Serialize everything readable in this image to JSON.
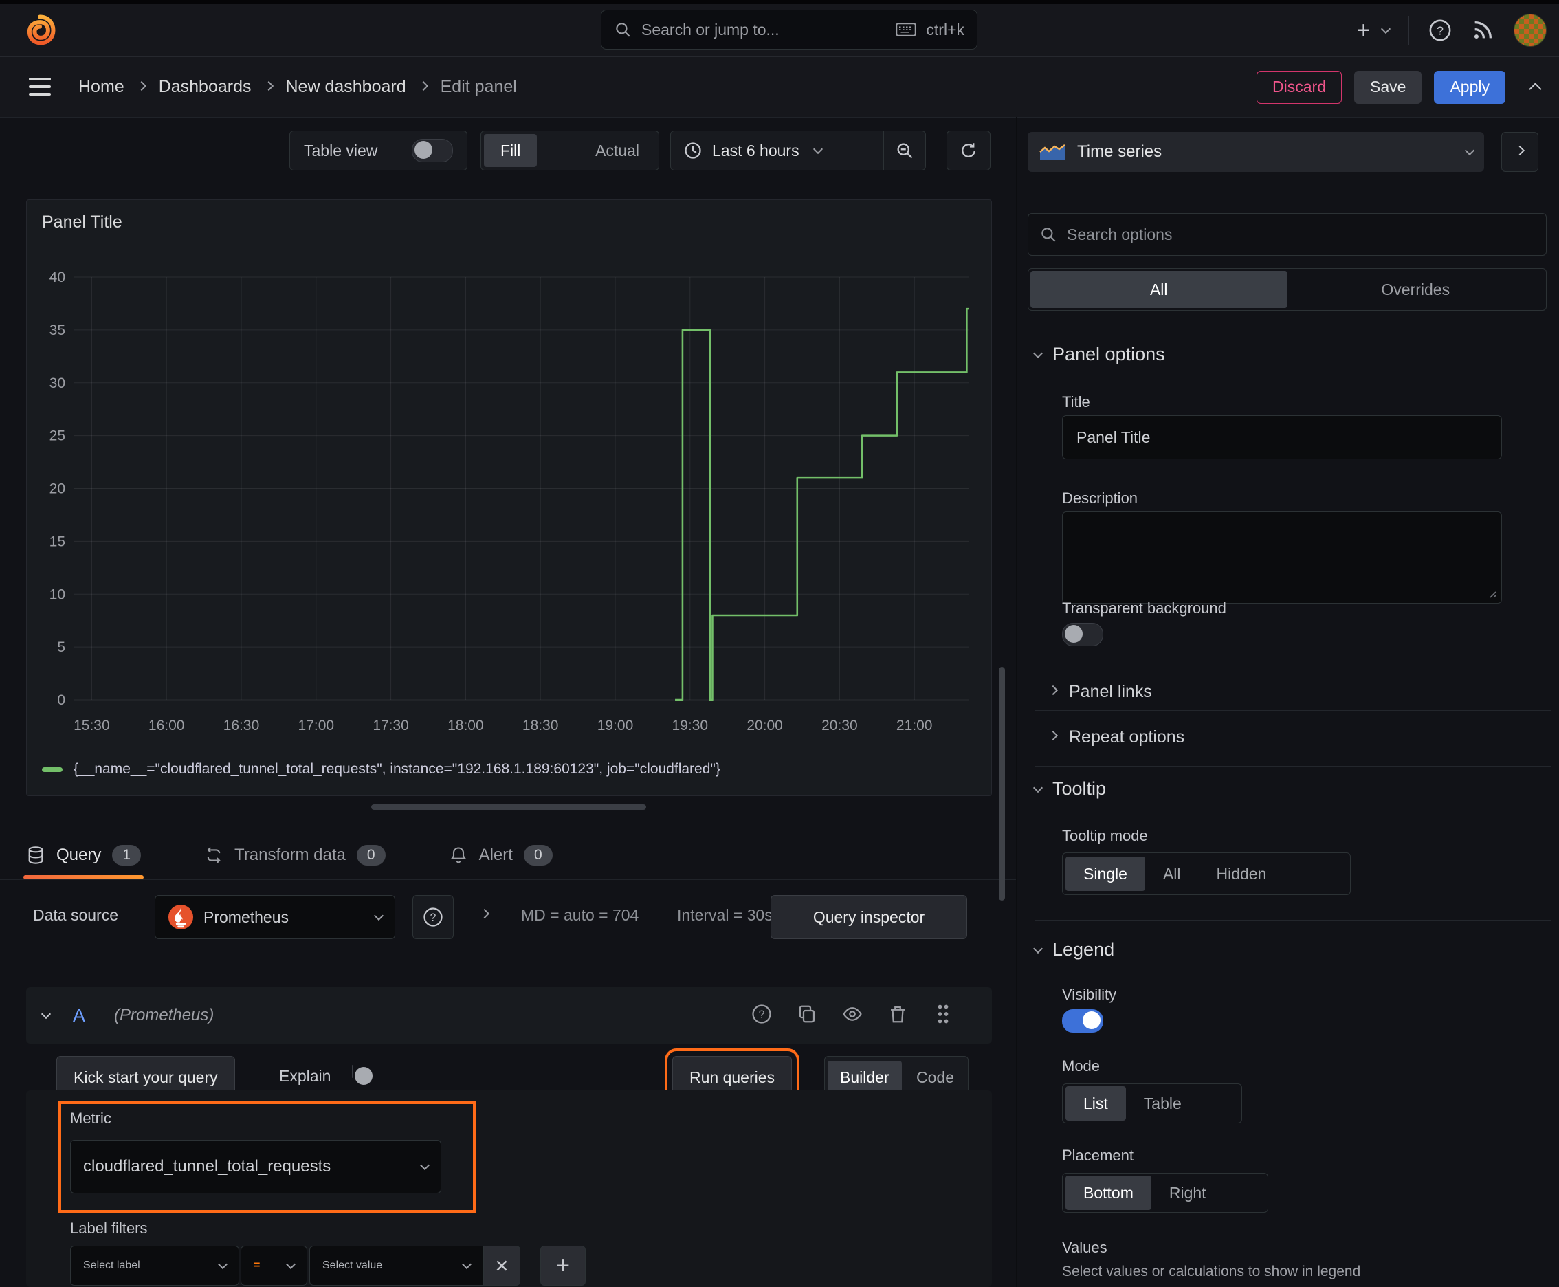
{
  "topbar": {
    "search_placeholder": "Search or jump to...",
    "search_shortcut": "ctrl+k"
  },
  "breadcrumb": {
    "items": [
      "Home",
      "Dashboards",
      "New dashboard",
      "Edit panel"
    ]
  },
  "nav_actions": {
    "discard": "Discard",
    "save": "Save",
    "apply": "Apply"
  },
  "toolbar": {
    "table_view": "Table view",
    "fill": "Fill",
    "actual": "Actual",
    "time_range": "Last 6 hours"
  },
  "panel": {
    "title": "Panel Title"
  },
  "chart_data": {
    "type": "line",
    "mode": "step",
    "title": "Panel Title",
    "series": [
      {
        "name": "{__name__=\"cloudflared_tunnel_total_requests\", instance=\"192.168.1.189:60123\", job=\"cloudflared\"}",
        "color": "#73bf69",
        "points": [
          [
            "19:24",
            0
          ],
          [
            "19:27",
            35
          ],
          [
            "19:38",
            0
          ],
          [
            "19:39",
            8
          ],
          [
            "20:13",
            21
          ],
          [
            "20:39",
            25
          ],
          [
            "20:53",
            31
          ],
          [
            "21:21",
            37
          ]
        ]
      }
    ],
    "ylim": [
      0,
      40
    ],
    "yticks": [
      0,
      5,
      10,
      15,
      20,
      25,
      30,
      35,
      40
    ],
    "xticks": [
      "15:30",
      "16:00",
      "16:30",
      "17:00",
      "17:30",
      "18:00",
      "18:30",
      "19:00",
      "19:30",
      "20:00",
      "20:30",
      "21:00"
    ],
    "x_range": [
      "15:23",
      "21:22"
    ],
    "grid": true,
    "legend_position": "bottom"
  },
  "tabs": {
    "query": "Query",
    "query_count": "1",
    "transform": "Transform data",
    "transform_count": "0",
    "alert": "Alert",
    "alert_count": "0"
  },
  "datasource_row": {
    "label": "Data source",
    "value": "Prometheus",
    "max_data_points": "MD = auto = 704",
    "interval": "Interval = 30s",
    "query_inspector": "Query inspector"
  },
  "query_editor": {
    "ref_id": "A",
    "datasource_hint": "(Prometheus)",
    "kick_start": "Kick start your query",
    "explain": "Explain",
    "run_queries": "Run queries",
    "builder": "Builder",
    "code": "Code",
    "metric_label": "Metric",
    "metric_value": "cloudflared_tunnel_total_requests",
    "label_filters_label": "Label filters",
    "select_label_placeholder": "Select label",
    "operator": "=",
    "select_value_placeholder": "Select value"
  },
  "options_pane": {
    "visualization": "Time series",
    "search_placeholder": "Search options",
    "tab_all": "All",
    "tab_overrides": "Overrides",
    "panel_options": {
      "header": "Panel options",
      "title_label": "Title",
      "title_value": "Panel Title",
      "description_label": "Description",
      "transparent_label": "Transparent background"
    },
    "collapsed": {
      "panel_links": "Panel links",
      "repeat_options": "Repeat options"
    },
    "tooltip": {
      "header": "Tooltip",
      "mode_label": "Tooltip mode",
      "single": "Single",
      "all": "All",
      "hidden": "Hidden"
    },
    "legend": {
      "header": "Legend",
      "visibility_label": "Visibility",
      "mode_label": "Mode",
      "list": "List",
      "table": "Table",
      "placement_label": "Placement",
      "bottom": "Bottom",
      "right": "Right",
      "values_label": "Values",
      "values_help": "Select values or calculations to show in legend"
    }
  },
  "colors": {
    "accent_orange": "#ff6b18",
    "green": "#73bf69",
    "blue": "#3d71d9",
    "discard_pink": "#e02f6a"
  }
}
